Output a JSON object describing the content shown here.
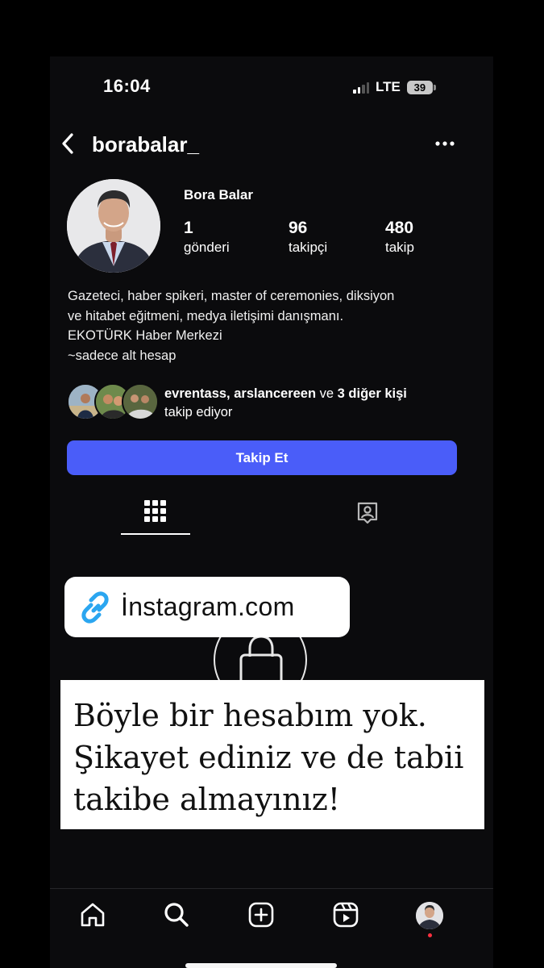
{
  "status_bar": {
    "time": "16:04",
    "network": "LTE",
    "battery": "39"
  },
  "header": {
    "username": "borabalar_",
    "back_icon": "chevron-left-icon",
    "more_icon": "more-horizontal-icon"
  },
  "profile": {
    "display_name": "Bora Balar",
    "stats": [
      {
        "value": "1",
        "label": "gönderi"
      },
      {
        "value": "96",
        "label": "takipçi"
      },
      {
        "value": "480",
        "label": "takip"
      }
    ],
    "bio_lines": [
      "Gazeteci, haber spikeri, master of ceremonies, diksiyon",
      "ve hitabet eğitmeni, medya iletişimi danışmanı.",
      "EKOTÜRK Haber Merkezi",
      "~sadece alt hesap"
    ],
    "followed_by": {
      "names": "evrentass, arslancereen",
      "connector": " ve ",
      "others": "3 diğer kişi",
      "suffix": "takip ediyor"
    },
    "follow_button": "Takip Et"
  },
  "tabs": {
    "grid_icon": "grid-icon",
    "tagged_icon": "tagged-icon",
    "active": "grid"
  },
  "overlay": {
    "link_label": "İnstagram.com",
    "link_icon": "link-icon",
    "note_lines": [
      "Böyle bir hesabım yok.",
      "Şikayet ediniz ve de tabii",
      "takibe almayınız!"
    ]
  },
  "bottom_nav": {
    "items": [
      "home-icon",
      "search-icon",
      "create-icon",
      "reels-icon",
      "profile-avatar"
    ]
  },
  "colors": {
    "background": "#0b0b0d",
    "accent": "#4a5df9",
    "link_icon": "#2ba6f0",
    "notification_dot": "#ff3040"
  }
}
